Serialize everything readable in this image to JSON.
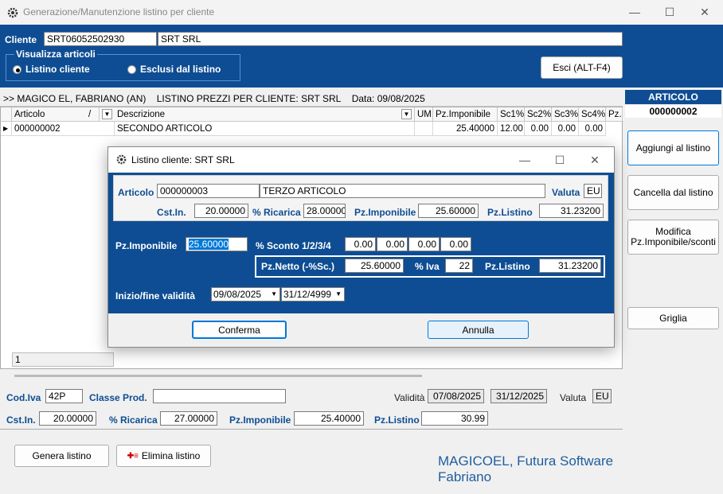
{
  "window": {
    "title": "Generazione/Manutenzione listino per cliente"
  },
  "header": {
    "cliente_label": "Cliente",
    "cliente_code": "SRT06052502930",
    "cliente_name": "SRT SRL",
    "group_label": "Visualizza articoli",
    "radio_listino": "Listino cliente",
    "radio_esclusi": "Esclusi dal listino",
    "exit_button": "Esci (ALT-F4)"
  },
  "grid_info": {
    "prefix": ">>",
    "company": "MAGICO EL, FABRIANO (AN)",
    "listino": "LISTINO PREZZI PER CLIENTE: SRT SRL",
    "data": "Data: 09/08/2025"
  },
  "grid": {
    "columns": [
      "Articolo",
      "/",
      "Descrizione",
      "UM",
      "Pz.Imponibile",
      "Sc1%",
      "Sc2%",
      "Sc3%",
      "Sc4%",
      "Pz."
    ],
    "rows": [
      {
        "articolo": "000000002",
        "descrizione": "SECONDO ARTICOLO",
        "um": "",
        "pz_imponibile": "25.40000",
        "sc1": "12.00",
        "sc2": "0.00",
        "sc3": "0.00",
        "sc4": "0.00"
      }
    ],
    "footer_count": "1"
  },
  "right_panel": {
    "header": "ARTICOLO",
    "code": "000000002",
    "btn_aggiungi": "Aggiungi al listino",
    "btn_cancella": "Cancella dal listino",
    "btn_modifica_1": "Modifica",
    "btn_modifica_2": "Pz.Imponibile/sconti",
    "btn_griglia": "Griglia"
  },
  "bottom": {
    "cod_iva_label": "Cod.Iva",
    "cod_iva": "42P",
    "classe_label": "Classe Prod.",
    "classe": "",
    "validita_label": "Validità",
    "validita_da": "07/08/2025",
    "validita_a": "31/12/2025",
    "valuta_label": "Valuta",
    "valuta": "EU",
    "cst_label": "Cst.In.",
    "cst": "20.00000",
    "ricarica_label": "% Ricarica",
    "ricarica": "27.00000",
    "imponibile_label": "Pz.Imponibile",
    "imponibile": "25.40000",
    "listino_label": "Pz.Listino",
    "listino": "30.99",
    "btn_genera": "Genera listino",
    "btn_elimina": "Elimina listino",
    "brand": "MAGICOEL, Futura Software Fabriano"
  },
  "dialog": {
    "title": "Listino cliente: SRT SRL",
    "articolo_label": "Articolo",
    "articolo_code": "000000003",
    "articolo_desc": "TERZO ARTICOLO",
    "valuta_label": "Valuta",
    "valuta": "EU",
    "cst_label": "Cst.In.",
    "cst": "20.00000",
    "ricarica_label": "% Ricarica",
    "ricarica": "28.00000",
    "imponibile_label": "Pz.Imponibile",
    "imponibile": "25.60000",
    "listino_label": "Pz.Listino",
    "listino": "31.23200",
    "edit_imponibile_label": "Pz.Imponibile",
    "edit_imponibile": "25.60000",
    "sconto_label": "% Sconto 1/2/3/4",
    "sconti": [
      "0.00",
      "0.00",
      "0.00",
      "0.00"
    ],
    "netto_label": "Pz.Netto (-%Sc.)",
    "netto": "25.60000",
    "iva_label": "% Iva",
    "iva": "22",
    "netto_listino_label": "Pz.Listino",
    "netto_listino": "31.23200",
    "validita_label": "Inizio/fine validità",
    "inizio": "09/08/2025",
    "fine": "31/12/4999",
    "btn_conferma": "Conferma",
    "btn_annulla": "Annulla"
  }
}
